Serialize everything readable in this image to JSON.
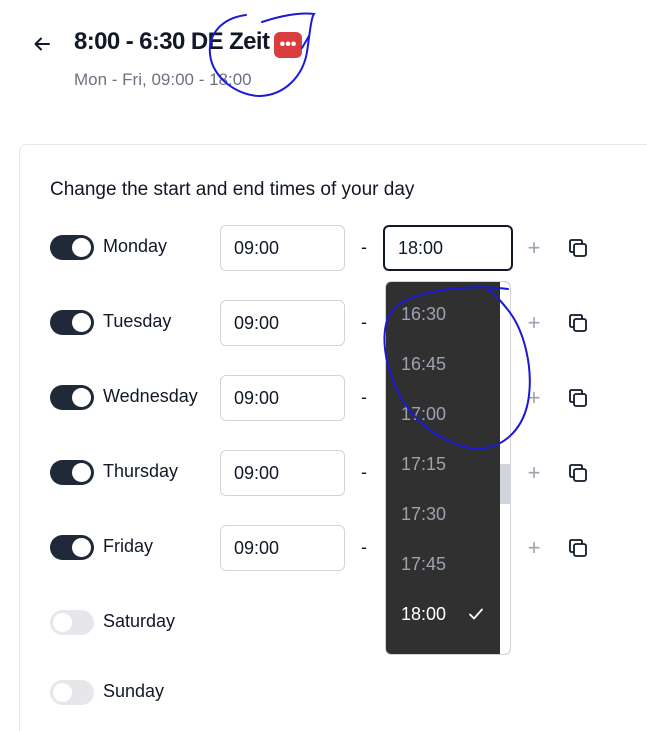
{
  "header": {
    "title": "8:00 - 6:30 DE Zeit",
    "subtitle": "Mon - Fri, 09:00 - 18:00",
    "badge_text": "•••"
  },
  "card": {
    "heading": "Change the start and end times of your day"
  },
  "days": [
    {
      "label": "Monday",
      "start": "09:00",
      "end": "18:00"
    },
    {
      "label": "Tuesday",
      "start": "09:00"
    },
    {
      "label": "Wednesday",
      "start": "09:00"
    },
    {
      "label": "Thursday",
      "start": "09:00"
    },
    {
      "label": "Friday",
      "start": "09:00"
    },
    {
      "label": "Saturday"
    },
    {
      "label": "Sunday"
    }
  ],
  "row_controls": {
    "dash": "-",
    "plus": "+"
  },
  "dropdown": {
    "options": [
      "16:30",
      "16:45",
      "17:00",
      "17:15",
      "17:30",
      "17:45",
      "18:00"
    ],
    "selected": "18:00"
  },
  "colors": {
    "toggle_on": "#1f2937",
    "toggle_off": "#e5e7eb",
    "dropdown_bg": "#303030",
    "badge": "#d93d3d",
    "annotation": "#1a1ad6"
  }
}
